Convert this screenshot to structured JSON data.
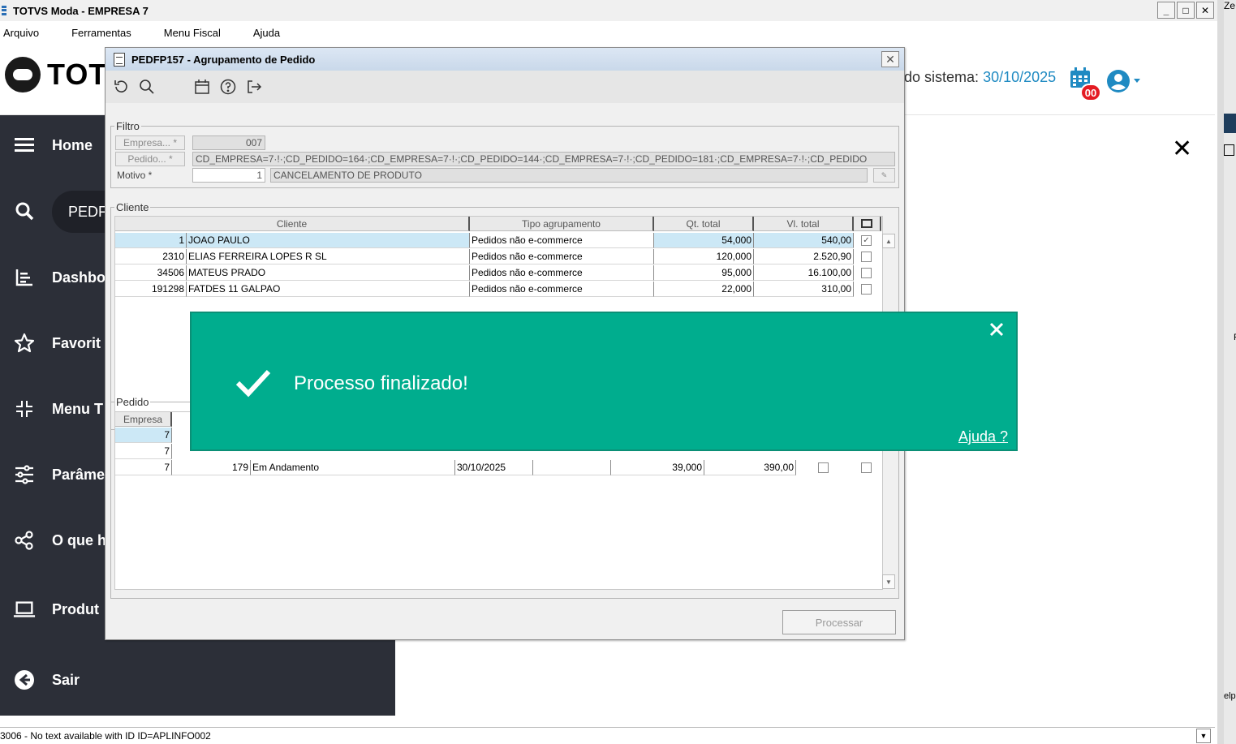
{
  "window": {
    "title": "TOTVS Moda - EMPRESA 7",
    "controls": [
      "_",
      "□",
      "✕"
    ]
  },
  "menu": [
    "Arquivo",
    "Ferramentas",
    "Menu Fiscal",
    "Ajuda"
  ],
  "right_strip": {
    "top_text": "Ze",
    "mid_text": "F",
    "bottom_text": "elp"
  },
  "app_header": {
    "logo_text": "TOT",
    "system_date_label": "do sistema:",
    "system_date_value": "30/10/2025",
    "notification_count": "00"
  },
  "sidebar": {
    "items": [
      {
        "label": "Home",
        "icon": "menu-icon"
      },
      {
        "label": "PEDF",
        "icon": "search-icon"
      },
      {
        "label": "Dashbo",
        "icon": "dashboard-icon"
      },
      {
        "label": "Favorit",
        "icon": "star-icon"
      },
      {
        "label": "Menu T",
        "icon": "compress-icon"
      },
      {
        "label": "Parâme",
        "icon": "sliders-icon"
      },
      {
        "label": "O que h",
        "icon": "share-icon"
      },
      {
        "label": "Produt",
        "icon": "laptop-icon"
      },
      {
        "label": "Sair",
        "icon": "logout-icon"
      }
    ]
  },
  "dialog": {
    "title": "PEDFP157 - Agrupamento de Pedido",
    "close_label": "✕",
    "filtro": {
      "legend": "Filtro",
      "empresa_btn": "Empresa... *",
      "empresa_value": "007",
      "pedido_btn": "Pedido... *",
      "pedido_value": "CD_EMPRESA=7·!·;CD_PEDIDO=164·;CD_EMPRESA=7·!·;CD_PEDIDO=144·;CD_EMPRESA=7·!·;CD_PEDIDO=181·;CD_EMPRESA=7·!·;CD_PEDIDO",
      "motivo_label": "Motivo *",
      "motivo_code": "1",
      "motivo_desc": "CANCELAMENTO DE PRODUTO"
    },
    "cliente": {
      "legend": "Cliente",
      "headers": [
        "Cliente",
        "Tipo agrupamento",
        "Qt. total",
        "Vl. total"
      ],
      "rows": [
        {
          "code": "1",
          "name": "JOAO PAULO",
          "tipo": "Pedidos não e-commerce",
          "qt": "54,000",
          "vl": "540,00",
          "checked": true
        },
        {
          "code": "2310",
          "name": "ELIAS FERREIRA LOPES  R  SL",
          "tipo": "Pedidos não e-commerce",
          "qt": "120,000",
          "vl": "2.520,90",
          "checked": false
        },
        {
          "code": "34506",
          "name": "MATEUS PRADO",
          "tipo": "Pedidos não e-commerce",
          "qt": "95,000",
          "vl": "16.100,00",
          "checked": false
        },
        {
          "code": "191298",
          "name": "FATDES 11 GALPAO",
          "tipo": "Pedidos não e-commerce",
          "qt": "22,000",
          "vl": "310,00",
          "checked": false
        }
      ]
    },
    "pedido": {
      "legend": "Pedido",
      "headers": [
        "Empresa"
      ],
      "rows": [
        {
          "empresa": "7"
        },
        {
          "empresa": "7"
        },
        {
          "empresa": "7",
          "pedido": "179",
          "situacao": "Em Andamento",
          "data": "30/10/2025",
          "qt": "39,000",
          "vl": "390,00"
        }
      ]
    },
    "process_button": "Processar"
  },
  "toast": {
    "message": "Processo finalizado!",
    "help_link": "Ajuda ?"
  },
  "status_bar": {
    "text": "3006 - No text available with ID ID=APLINFO002"
  },
  "colors": {
    "toast_bg": "#00ad8e",
    "sidebar_bg": "#2c2f38",
    "accent_blue": "#1f8ac2",
    "badge_red": "#e41b23"
  }
}
